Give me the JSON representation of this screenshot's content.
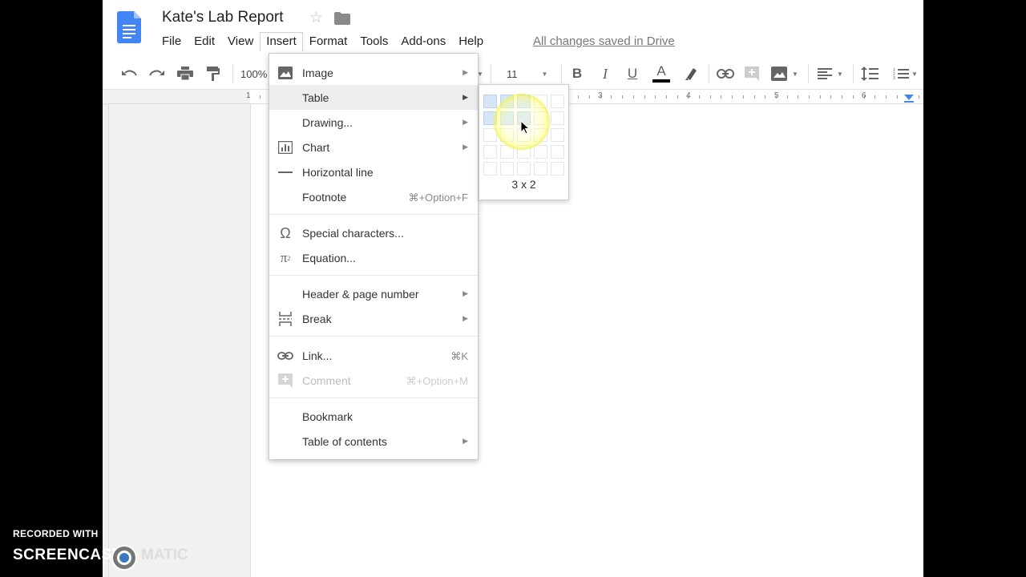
{
  "document": {
    "title": "Kate's Lab Report"
  },
  "menubar": {
    "items": [
      "File",
      "Edit",
      "View",
      "Insert",
      "Format",
      "Tools",
      "Add-ons",
      "Help"
    ],
    "active": "Insert",
    "save_status": "All changes saved in Drive"
  },
  "toolbar": {
    "zoom": "100%",
    "font_size": "11"
  },
  "ruler": {
    "labels": [
      "1",
      "3",
      "4",
      "5",
      "6"
    ]
  },
  "insert_menu": {
    "items": [
      {
        "label": "Image",
        "icon": "image-icon",
        "submenu": true
      },
      {
        "label": "Table",
        "submenu": true,
        "highlighted": true
      },
      {
        "label": "Drawing...",
        "submenu": true
      },
      {
        "label": "Chart",
        "icon": "chart-icon",
        "submenu": true
      },
      {
        "label": "Horizontal line",
        "icon": "horizontal-line-icon"
      },
      {
        "label": "Footnote",
        "shortcut": "⌘+Option+F"
      },
      {
        "label": "Special characters...",
        "icon": "omega-icon"
      },
      {
        "label": "Equation...",
        "icon": "pi-icon"
      },
      {
        "label": "Header & page number",
        "submenu": true
      },
      {
        "label": "Break",
        "icon": "break-icon",
        "submenu": true
      },
      {
        "label": "Link...",
        "icon": "link-icon",
        "shortcut": "⌘K"
      },
      {
        "label": "Comment",
        "icon": "comment-icon",
        "shortcut": "⌘+Option+M",
        "disabled": true
      },
      {
        "label": "Bookmark"
      },
      {
        "label": "Table of contents",
        "submenu": true
      }
    ]
  },
  "table_picker": {
    "size_label": "3 x 2",
    "selected_columns": 3,
    "selected_rows": 2
  },
  "watermark": {
    "top": "RECORDED WITH",
    "left": "SCREENCAST",
    "right": "MATIC"
  },
  "colors": {
    "docs_blue": "#4285f4",
    "highlight_yellow": "#f0f046",
    "selection_blue": "#d6e6f6"
  }
}
